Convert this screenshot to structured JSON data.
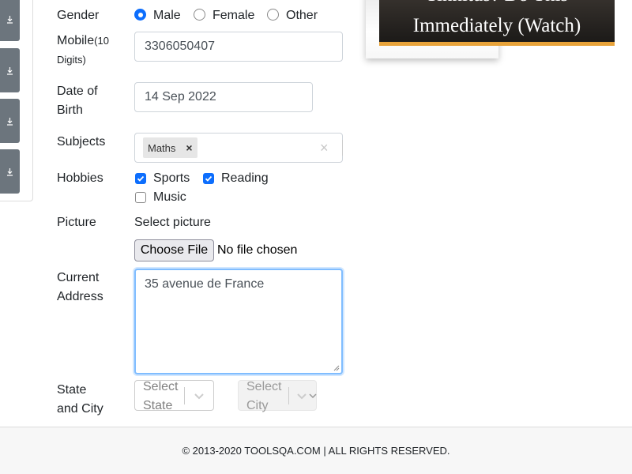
{
  "form": {
    "gender": {
      "label": "Gender",
      "options": [
        "Male",
        "Female",
        "Other"
      ],
      "selected": "Male"
    },
    "mobile": {
      "label": "Mobile",
      "hint": "(10 Digits)",
      "value": "3306050407"
    },
    "dob": {
      "label_line1": "Date of",
      "label_line2": "Birth",
      "value": "14 Sep 2022"
    },
    "subjects": {
      "label": "Subjects",
      "chips": [
        "Maths"
      ],
      "chip_remove": "×",
      "clear": "×"
    },
    "hobbies": {
      "label": "Hobbies",
      "options": [
        {
          "label": "Sports",
          "checked": true
        },
        {
          "label": "Reading",
          "checked": true
        },
        {
          "label": "Music",
          "checked": false
        }
      ]
    },
    "picture": {
      "label": "Picture",
      "select_label": "Select picture",
      "button": "Choose File",
      "status": "No file chosen"
    },
    "address": {
      "label_line1": "Current",
      "label_line2": "Address",
      "value": "35 avenue de France"
    },
    "state_city": {
      "label_line1": "State",
      "label_line2": "and City",
      "state_placeholder_line1": "Select",
      "state_placeholder_line2": "State",
      "city_placeholder_line1": "Select",
      "city_placeholder_line2": "City"
    }
  },
  "ad": {
    "headline_line1": "Tinnitus? Do This",
    "headline_line2": "Immediately (Watch)"
  },
  "footer": {
    "text": "© 2013-2020 TOOLSQA.COM | ALL RIGHTS RESERVED."
  },
  "colors": {
    "accent": "#0d6efd",
    "sidebar_button": "#6c757d",
    "ad_underline": "#e8a33a"
  },
  "icons": {
    "sidebar_buttons": [
      "download-icon",
      "download-icon",
      "download-icon",
      "download-icon"
    ]
  }
}
